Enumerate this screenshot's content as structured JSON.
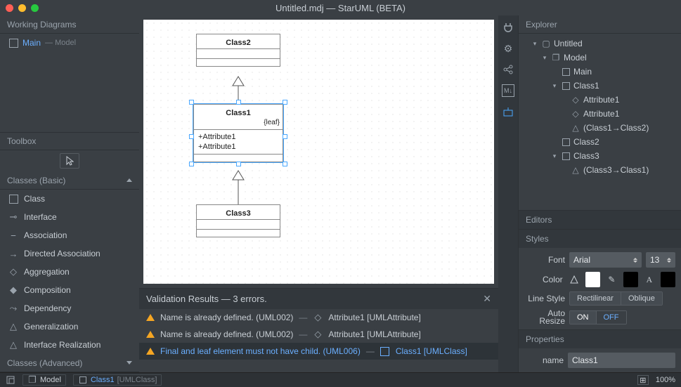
{
  "title": "Untitled.mdj — StarUML (BETA)",
  "left": {
    "working_diagrams_header": "Working Diagrams",
    "wd_main": "Main",
    "wd_model": "— Model",
    "toolbox_header": "Toolbox",
    "classes_basic_header": "Classes (Basic)",
    "classes_advanced_header": "Classes (Advanced)",
    "tools": [
      "Class",
      "Interface",
      "Association",
      "Directed Association",
      "Aggregation",
      "Composition",
      "Dependency",
      "Generalization",
      "Interface Realization"
    ]
  },
  "canvas": {
    "class2": {
      "name": "Class2"
    },
    "class1": {
      "name": "Class1",
      "constraint": "{leaf}",
      "attrs": [
        "+Attribute1",
        "+Attribute1"
      ]
    },
    "class3": {
      "name": "Class3"
    }
  },
  "validation": {
    "header": "Validation Results — 3 errors.",
    "rows": [
      {
        "msg": "Name is already defined. (UML002)",
        "element": "Attribute1 [UMLAttribute]"
      },
      {
        "msg": "Name is already defined. (UML002)",
        "element": "Attribute1 [UMLAttribute]"
      },
      {
        "msg": "Final and leaf element must not have child. (UML006)",
        "element": "Class1 [UMLClass]"
      }
    ]
  },
  "explorer": {
    "header": "Explorer",
    "nodes": {
      "untitled": "Untitled",
      "model": "Model",
      "main": "Main",
      "class1": "Class1",
      "attr1a": "Attribute1",
      "attr1b": "Attribute1",
      "gen1": "(Class1→Class2)",
      "class2": "Class2",
      "class3": "Class3",
      "gen2": "(Class3→Class1)"
    }
  },
  "editors_header": "Editors",
  "styles": {
    "header": "Styles",
    "font_label": "Font",
    "font_value": "Arial",
    "font_size": "13",
    "color_label": "Color",
    "linestyle_label": "Line Style",
    "rectilinear": "Rectilinear",
    "oblique": "Oblique",
    "autoresize_label1": "Auto",
    "autoresize_label2": "Resize",
    "on": "ON",
    "off": "OFF"
  },
  "properties": {
    "header": "Properties",
    "name_label": "name",
    "name_value": "Class1"
  },
  "statusbar": {
    "model": "Model",
    "class1": "Class1",
    "class1_type": "[UMLClass]",
    "zoom": "100%"
  }
}
